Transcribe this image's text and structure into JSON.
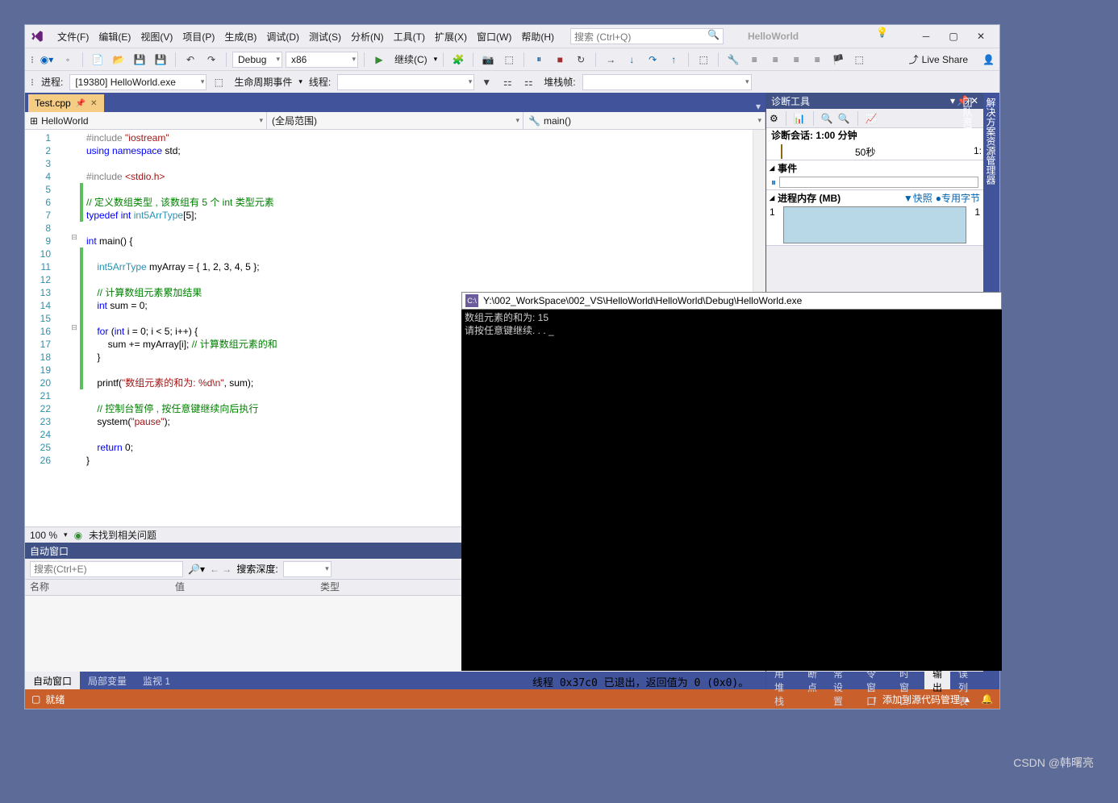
{
  "menubar": {
    "items": [
      "文件(F)",
      "编辑(E)",
      "视图(V)",
      "项目(P)",
      "生成(B)",
      "调试(D)",
      "测试(S)",
      "分析(N)",
      "工具(T)",
      "扩展(X)",
      "窗口(W)",
      "帮助(H)"
    ],
    "search_placeholder": "搜索 (Ctrl+Q)",
    "solution": "HelloWorld"
  },
  "toolbar": {
    "config": "Debug",
    "platform": "x86",
    "continue": "继续(C)",
    "liveshare": "Live Share"
  },
  "toolbar2": {
    "process_label": "进程:",
    "process_value": "[19380] HelloWorld.exe",
    "lifecycle": "生命周期事件",
    "thread": "线程:",
    "stackframe": "堆栈帧:"
  },
  "tabs": {
    "active": "Test.cpp"
  },
  "nav": {
    "project": "HelloWorld",
    "scope": "(全局范围)",
    "func": "main()"
  },
  "code_lines": [
    {
      "n": 1,
      "html": "<span class='pp'>#include</span> <span class='str'>\"iostream\"</span>"
    },
    {
      "n": 2,
      "html": "<span class='kw'>using namespace</span> std;"
    },
    {
      "n": 3,
      "html": ""
    },
    {
      "n": 4,
      "html": "<span class='pp'>#include</span> <span class='str'>&lt;stdio.h&gt;</span>"
    },
    {
      "n": 5,
      "html": "",
      "bar": true
    },
    {
      "n": 6,
      "html": "<span class='cm'>// 定义数组类型 , 该数组有 5 个 int 类型元素</span>",
      "bar": true
    },
    {
      "n": 7,
      "html": "<span class='kw'>typedef</span> <span class='kw'>int</span> <span class='ty'>int5ArrType</span>[<span class='num'>5</span>];",
      "bar": true
    },
    {
      "n": 8,
      "html": ""
    },
    {
      "n": 9,
      "html": "<span class='kw'>int</span> main() {",
      "fold": "-"
    },
    {
      "n": 10,
      "html": "",
      "bar": true
    },
    {
      "n": 11,
      "html": "    <span class='ty'>int5ArrType</span> myArray = { <span class='num'>1</span>, <span class='num'>2</span>, <span class='num'>3</span>, <span class='num'>4</span>, <span class='num'>5</span> };",
      "bar": true
    },
    {
      "n": 12,
      "html": "",
      "bar": true
    },
    {
      "n": 13,
      "html": "    <span class='cm'>// 计算数组元素累加结果</span>",
      "bar": true
    },
    {
      "n": 14,
      "html": "    <span class='kw'>int</span> sum = <span class='num'>0</span>;",
      "bar": true
    },
    {
      "n": 15,
      "html": "",
      "bar": true
    },
    {
      "n": 16,
      "html": "    <span class='kw'>for</span> (<span class='kw'>int</span> i = <span class='num'>0</span>; i &lt; <span class='num'>5</span>; i++) {",
      "bar": true,
      "fold": "-"
    },
    {
      "n": 17,
      "html": "        sum += myArray[i]; <span class='cm'>// 计算数组元素的和</span>",
      "bar": true
    },
    {
      "n": 18,
      "html": "    }",
      "bar": true
    },
    {
      "n": 19,
      "html": "",
      "bar": true
    },
    {
      "n": 20,
      "html": "    printf(<span class='str'>\"数组元素的和为: %d\\n\"</span>, sum);",
      "bar": true
    },
    {
      "n": 21,
      "html": ""
    },
    {
      "n": 22,
      "html": "    <span class='cm'>// 控制台暂停 , 按任意键继续向后执行</span>"
    },
    {
      "n": 23,
      "html": "    system(<span class='str'>\"pause\"</span>);"
    },
    {
      "n": 24,
      "html": ""
    },
    {
      "n": 25,
      "html": "    <span class='kw'>return</span> <span class='num'>0</span>;"
    },
    {
      "n": 26,
      "html": "}"
    }
  ],
  "zoom": {
    "level": "100 %",
    "issues": "未找到相关问题"
  },
  "auto": {
    "title": "自动窗口",
    "search_placeholder": "搜索(Ctrl+E)",
    "depth": "搜索深度:",
    "cols": [
      "名称",
      "值",
      "类型"
    ]
  },
  "btabs_left": [
    "自动窗口",
    "局部变量",
    "监视 1"
  ],
  "btabs_right": [
    "调用堆栈",
    "断点",
    "异常设置",
    "命令窗口",
    "即时窗口",
    "输出",
    "错误列表"
  ],
  "diag": {
    "title": "诊断工具",
    "session": "诊断会话: 1:00 分钟",
    "time50": "50秒",
    "time1": "1:",
    "events": "事件",
    "mem": "进程内存 (MB)",
    "snapshot": "快照",
    "private": "专用字节",
    "one": "1"
  },
  "sidebar": [
    "解决方案资源管理器",
    "团队资源管理器"
  ],
  "status": {
    "ready": "就绪",
    "src": "添加到源代码管理"
  },
  "console": {
    "title": "Y:\\002_WorkSpace\\002_VS\\HelloWorld\\HelloWorld\\Debug\\HelloWorld.exe",
    "lines": [
      "数组元素的和为: 15",
      "请按任意键继续. . . _"
    ]
  },
  "output": "线程 0x37c0 已退出，返回值为 0 (0x0)。",
  "watermark": "CSDN @韩曙亮"
}
